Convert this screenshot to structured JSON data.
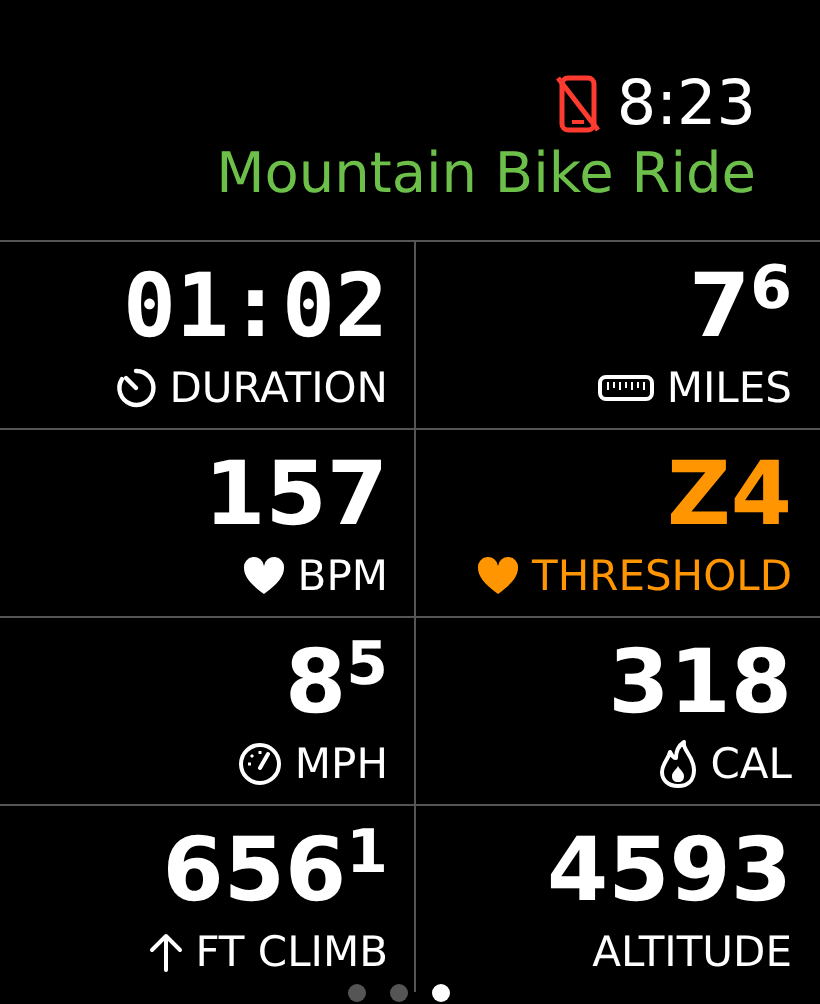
{
  "status": {
    "time": "8:23",
    "phone_disconnected": true
  },
  "title": "Mountain Bike Ride",
  "metrics": [
    {
      "value": "01:02",
      "label": "DURATION",
      "kind": "timer",
      "color": "#ffffff"
    },
    {
      "value": "7$^{6}$",
      "label": "MILES",
      "kind": "distance",
      "color": "#ffffff"
    },
    {
      "value": "157",
      "label": "BPM",
      "kind": "heart",
      "color": "#ffffff"
    },
    {
      "value": "Z4",
      "label": "THRESHOLD",
      "kind": "heart",
      "color": "#ff9500"
    },
    {
      "value": "8$^{5}$",
      "label": "MPH",
      "kind": "speed",
      "color": "#ffffff"
    },
    {
      "value": "318",
      "label": "CAL",
      "kind": "energy",
      "color": "#ffffff"
    },
    {
      "value": "656$^{1}$",
      "label": "FT CLIMB",
      "kind": "climb",
      "color": "#ffffff"
    },
    {
      "value": "4593",
      "label": "ALTITUDE",
      "kind": "plain",
      "color": "#ffffff"
    }
  ],
  "page_dots": [
    {
      "selected": false
    },
    {
      "selected": false
    },
    {
      "selected": true
    }
  ]
}
